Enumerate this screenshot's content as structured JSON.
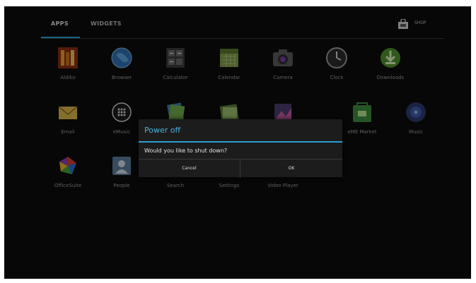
{
  "tabs": {
    "apps": "APPS",
    "widgets": "WIDGETS"
  },
  "shop": {
    "label": "SHOP"
  },
  "apps": [
    {
      "label": "Aldiko",
      "icon": "aldiko-icon"
    },
    {
      "label": "Browser",
      "icon": "browser-icon"
    },
    {
      "label": "Calculator",
      "icon": "calculator-icon"
    },
    {
      "label": "Calendar",
      "icon": "calendar-icon"
    },
    {
      "label": "Camera",
      "icon": "camera-icon"
    },
    {
      "label": "Clock",
      "icon": "clock-icon"
    },
    {
      "label": "Downloads",
      "icon": "downloads-icon"
    },
    {
      "label": "Email",
      "icon": "email-icon"
    },
    {
      "label": "eMusic",
      "icon": "emusic-icon"
    },
    {
      "label": "",
      "icon": "gallery-icon"
    },
    {
      "label": "",
      "icon": "file-manager-icon"
    },
    {
      "label": "",
      "icon": "photo-icon"
    },
    {
      "label": "eME Market",
      "icon": "market-icon"
    },
    {
      "label": "Music",
      "icon": "music-icon"
    },
    {
      "label": "OfficeSuite",
      "icon": "officesuite-icon"
    },
    {
      "label": "People",
      "icon": "people-icon"
    },
    {
      "label": "Search",
      "icon": "search-icon"
    },
    {
      "label": "Settings",
      "icon": "settings-icon"
    },
    {
      "label": "Video Player",
      "icon": "video-player-icon"
    }
  ],
  "dialog": {
    "title": "Power off",
    "message": "Would you like to shut down?",
    "cancel": "Cancel",
    "ok": "OK"
  },
  "colors": {
    "accent": "#2b9fd0",
    "background": "#0c0c0c",
    "dialog": "#1c1c1c"
  }
}
